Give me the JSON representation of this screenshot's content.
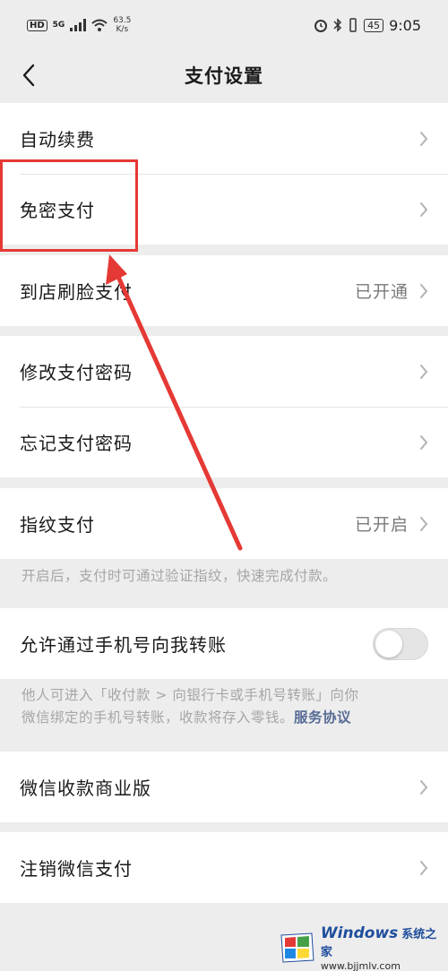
{
  "status_bar": {
    "hd": "HD",
    "network": "5G",
    "speed_value": "63.5",
    "speed_unit": "K/s",
    "battery": "45",
    "time": "9:05"
  },
  "navbar": {
    "title": "支付设置"
  },
  "groups": {
    "g1": {
      "auto_renew": "自动续费",
      "password_free": "免密支付"
    },
    "g2": {
      "face_pay": "到店刷脸支付",
      "face_pay_status": "已开通"
    },
    "g3": {
      "change_password": "修改支付密码",
      "forgot_password": "忘记支付密码"
    },
    "g4": {
      "fingerprint": "指纹支付",
      "fingerprint_status": "已开启",
      "fingerprint_note": "开启后，支付时可通过验证指纹，快速完成付款。"
    },
    "g5": {
      "phone_transfer": "允许通过手机号向我转账",
      "phone_transfer_on": false,
      "note_line1": "他人可进入「收付款 > 向银行卡或手机号转账」向你",
      "note_line2": "微信绑定的手机号转账，收款将存入零钱。",
      "note_link": "服务协议"
    },
    "g6": {
      "merchant": "微信收款商业版"
    },
    "g7": {
      "cancel_pay": "注销微信支付"
    }
  },
  "watermark": {
    "brand": "Windows",
    "brand_cn": "系统之家",
    "url": "www.bjjmlv.com"
  },
  "colors": {
    "annotation": "#e53935",
    "link": "#576b95",
    "background": "#ededed"
  }
}
